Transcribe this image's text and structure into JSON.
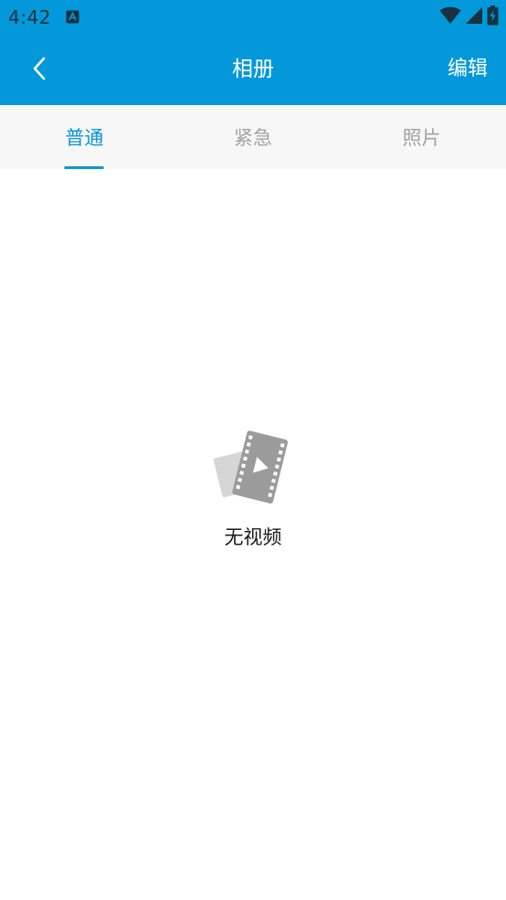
{
  "status_bar": {
    "time": "4:42",
    "icons": [
      "notification-a-icon",
      "wifi-icon",
      "cell-signal-icon",
      "battery-charging-icon"
    ]
  },
  "app_bar": {
    "back_icon": "chevron-left-icon",
    "title": "相册",
    "edit_label": "编辑"
  },
  "tabs": [
    {
      "label": "普通",
      "active": true
    },
    {
      "label": "紧急",
      "active": false
    },
    {
      "label": "照片",
      "active": false
    }
  ],
  "empty_state": {
    "icon": "video-film-icon",
    "text": "无视频"
  },
  "colors": {
    "primary": "#0398da",
    "tab_active": "#0a96d8",
    "tab_inactive": "#a3a3a3",
    "tab_bar_bg": "#f7f7f7",
    "empty_icon": "#9e9e9e"
  }
}
